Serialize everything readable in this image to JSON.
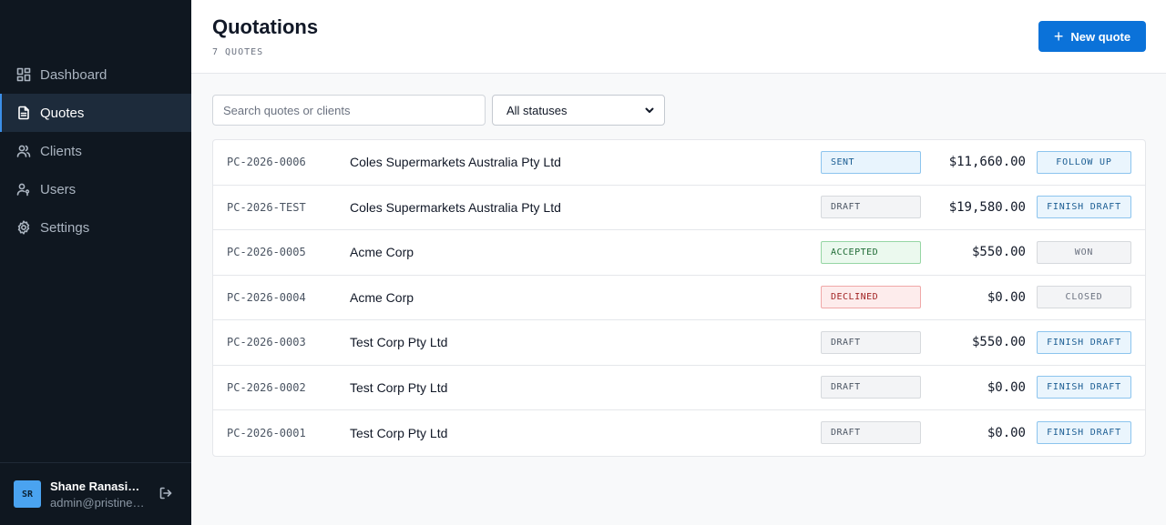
{
  "sidebar": {
    "nav": [
      {
        "label": "Dashboard",
        "icon": "dashboard-icon"
      },
      {
        "label": "Quotes",
        "icon": "document-icon",
        "active": true
      },
      {
        "label": "Clients",
        "icon": "users-icon"
      },
      {
        "label": "Users",
        "icon": "user-key-icon"
      },
      {
        "label": "Settings",
        "icon": "gear-icon"
      }
    ],
    "user": {
      "initials": "SR",
      "name": "Shane Ranasin…",
      "email": "admin@pristinec…"
    }
  },
  "header": {
    "title": "Quotations",
    "count": "7 QUOTES",
    "new_button": "New quote"
  },
  "filters": {
    "search_placeholder": "Search quotes or clients",
    "status_value": "All statuses"
  },
  "quotes": [
    {
      "id": "PC-2026-0006",
      "client": "Coles Supermarkets Australia Pty Ltd",
      "status": "SENT",
      "amount": "$11,660.00",
      "action": "FOLLOW UP"
    },
    {
      "id": "PC-2026-TEST",
      "client": "Coles Supermarkets Australia Pty Ltd",
      "status": "DRAFT",
      "amount": "$19,580.00",
      "action": "FINISH DRAFT"
    },
    {
      "id": "PC-2026-0005",
      "client": "Acme Corp",
      "status": "ACCEPTED",
      "amount": "$550.00",
      "action": "WON"
    },
    {
      "id": "PC-2026-0004",
      "client": "Acme Corp",
      "status": "DECLINED",
      "amount": "$0.00",
      "action": "CLOSED"
    },
    {
      "id": "PC-2026-0003",
      "client": "Test Corp Pty Ltd",
      "status": "DRAFT",
      "amount": "$550.00",
      "action": "FINISH DRAFT"
    },
    {
      "id": "PC-2026-0002",
      "client": "Test Corp Pty Ltd",
      "status": "DRAFT",
      "amount": "$0.00",
      "action": "FINISH DRAFT"
    },
    {
      "id": "PC-2026-0001",
      "client": "Test Corp Pty Ltd",
      "status": "DRAFT",
      "amount": "$0.00",
      "action": "FINISH DRAFT"
    }
  ],
  "colors": {
    "sidebar_bg": "#0f1720",
    "accent": "#0b72d9",
    "sent": "#1b5d93",
    "accepted": "#1f6b35",
    "declined": "#a22424"
  }
}
